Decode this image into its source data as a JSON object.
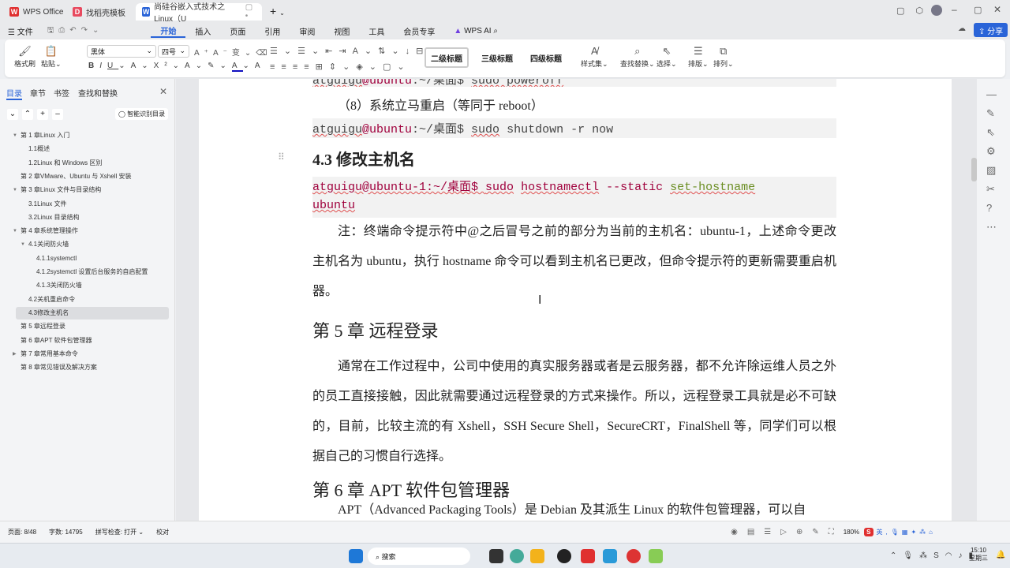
{
  "tabs": [
    {
      "label": "WPS Office"
    },
    {
      "label": "找稻壳模板"
    },
    {
      "label": "尚硅谷嵌入式技术之Linux（U"
    }
  ],
  "window": {
    "share_label": "分享"
  },
  "menu": [
    "文件",
    "开始",
    "插入",
    "页面",
    "引用",
    "审阅",
    "视图",
    "工具",
    "会员专享",
    "WPS AI"
  ],
  "ribbon": {
    "format_painter": "格式刷",
    "paste": "粘贴",
    "font": "黑体",
    "size": "四号",
    "styles": [
      "二级标题",
      "三级标题",
      "四级标题"
    ],
    "style_set": "样式集",
    "find_replace": "查找替换",
    "select": "选择",
    "layout": "排版",
    "arrange": "排列"
  },
  "panel": {
    "tabs": [
      "目录",
      "章节",
      "书签",
      "查找和替换"
    ],
    "smart_toc": "智能识别目录",
    "toc": [
      {
        "label": "第 1 章Linux 入门",
        "level": 0,
        "arrow": "▼"
      },
      {
        "label": "1.1概述",
        "level": 1
      },
      {
        "label": "1.2Linux 和 Windows 区别",
        "level": 1
      },
      {
        "label": "第 2 章VMware、Ubuntu 与 Xshell 安装",
        "level": 0
      },
      {
        "label": "第 3 章Linux 文件与目录结构",
        "level": 0,
        "arrow": "▼"
      },
      {
        "label": "3.1Linux 文件",
        "level": 1
      },
      {
        "label": "3.2Linux 目录结构",
        "level": 1
      },
      {
        "label": "第 4 章系统管理操作",
        "level": 0,
        "arrow": "▼"
      },
      {
        "label": "4.1关闭防火墙",
        "level": 1,
        "arrow": "▼"
      },
      {
        "label": "4.1.1systemctl",
        "level": 2
      },
      {
        "label": "4.1.2systemctl 设置后台服务的自启配置",
        "level": 2
      },
      {
        "label": "4.1.3关闭防火墙",
        "level": 2
      },
      {
        "label": "4.2关机重启命令",
        "level": 1
      },
      {
        "label": "4.3修改主机名",
        "level": 1,
        "selected": true
      },
      {
        "label": "第 5 章远程登录",
        "level": 0
      },
      {
        "label": "第 6 章APT 软件包管理器",
        "level": 0
      },
      {
        "label": "第 7 章常用基本命令",
        "level": 0,
        "arrow": "▶"
      },
      {
        "label": "第 8 章常见错误及解决方案",
        "level": 0
      }
    ]
  },
  "doc": {
    "code1": {
      "user": "atguigu",
      "host": "@ubuntu",
      "path": ":~/桌面$ ",
      "cmd": "sudo poweroff"
    },
    "item8": "（8）系统立马重启（等同于 reboot）",
    "code2": {
      "user": "atguigu",
      "host": "@ubuntu",
      "path": ":~/桌面$ ",
      "sudo": "sudo",
      "rest": " shutdown -r now"
    },
    "h43": "4.3  修改主机名",
    "code3": {
      "prompt": "atguigu@ubuntu-1:~/桌面$ ",
      "sudo": "sudo",
      "cmd": "hostnamectl",
      "opt": " --static ",
      "arg": "set-hostname",
      "arg2": "ubuntu"
    },
    "note": "注：终端命令提示符中@之后冒号之前的部分为当前的主机名：ubuntu-1，上述命令更改主机名为 ubuntu，执行 hostname 命令可以看到主机名已更改，但命令提示符的更新需要重启机器。",
    "ch5": "第  5  章  远程登录",
    "ch5_para": "通常在工作过程中，公司中使用的真实服务器或者是云服务器，都不允许除运维人员之外的员工直接接触，因此就需要通过远程登录的方式来操作。所以，远程登录工具就是必不可缺的，目前，比较主流的有 Xshell，SSH Secure Shell，SecureCRT，FinalShell 等，同学们可以根据自己的习惯自行选择。",
    "ch6": "第  6  章  APT 软件包管理器",
    "ch6_para": "APT（Advanced Packaging Tools）是 Debian 及其派生 Linux 的软件包管理器，可以自"
  },
  "status": {
    "page": "页面: 8/48",
    "words": "字数: 14795",
    "spell": "拼写检查: 打开",
    "proof": "校对",
    "zoom": "180%"
  },
  "taskbar": {
    "search": "搜索",
    "time": "15:10",
    "day": "星期三"
  },
  "colors": {
    "accent": "#2a64d8",
    "wps_red": "#e03030"
  }
}
